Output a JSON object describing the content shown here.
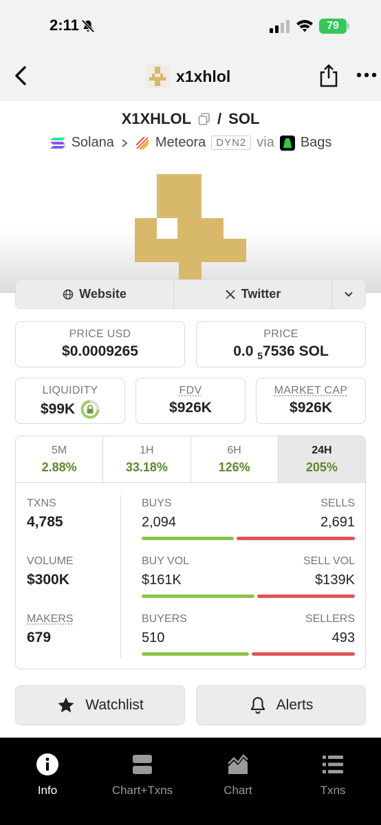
{
  "status_bar": {
    "time": "2:11",
    "battery": "79"
  },
  "header": {
    "title": "x1xhlol"
  },
  "pair": {
    "base": "X1XHLOL",
    "separator": "/",
    "quote": "SOL",
    "chain": "Solana",
    "dex": "Meteora",
    "dex_tag": "DYN2",
    "via_label": "via",
    "launchpad": "Bags"
  },
  "links": {
    "website": "Website",
    "twitter": "Twitter"
  },
  "stats": {
    "price_usd_label": "PRICE USD",
    "price_usd": "$0.0009265",
    "price_label": "PRICE",
    "price_native_prefix": "0.0",
    "price_native_subscript": "5",
    "price_native_rest": "7536 SOL",
    "liquidity_label": "LIQUIDITY",
    "liquidity": "$99K",
    "fdv_label": "FDV",
    "fdv": "$926K",
    "mcap_label": "MARKET CAP",
    "mcap": "$926K"
  },
  "timeframes": [
    {
      "label": "5M",
      "change": "2.88%"
    },
    {
      "label": "1H",
      "change": "33.18%"
    },
    {
      "label": "6H",
      "change": "126%"
    },
    {
      "label": "24H",
      "change": "205%"
    }
  ],
  "txns": {
    "txns_label": "TXNS",
    "txns": "4,785",
    "volume_label": "VOLUME",
    "volume": "$300K",
    "makers_label": "MAKERS",
    "makers": "679",
    "buys_label": "BUYS",
    "buys": "2,094",
    "sells_label": "SELLS",
    "sells": "2,691",
    "buy_vol_label": "BUY VOL",
    "buy_vol": "$161K",
    "sell_vol_label": "SELL VOL",
    "sell_vol": "$139K",
    "buyers_label": "BUYERS",
    "buyers": "510",
    "sellers_label": "SELLERS",
    "sellers": "493",
    "buy_share": 0.4376,
    "buy_vol_share": 0.5367,
    "buyers_share": 0.5085
  },
  "actions": {
    "watchlist": "Watchlist",
    "alerts": "Alerts"
  },
  "tabbar": [
    {
      "label": "Info",
      "icon": "info-icon"
    },
    {
      "label": "Chart+Txns",
      "icon": "split-panel-icon"
    },
    {
      "label": "Chart",
      "icon": "area-chart-icon"
    },
    {
      "label": "Txns",
      "icon": "list-icon"
    }
  ],
  "colors": {
    "positive": "#5a8a2a",
    "buy_bar": "#8bc34a",
    "sell_bar": "#e05555",
    "logo_gold": "#d8b86a"
  }
}
